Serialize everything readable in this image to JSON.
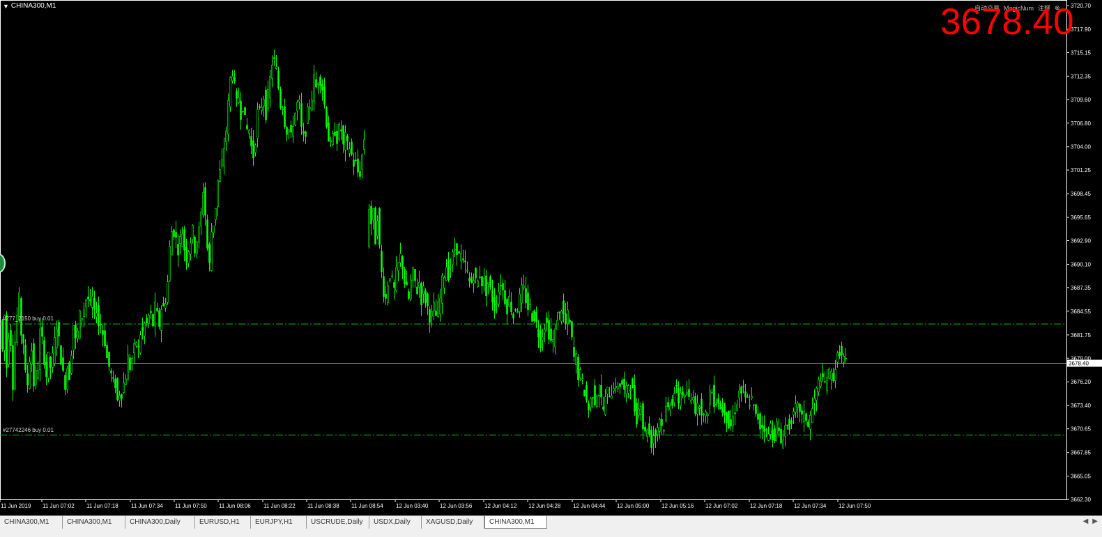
{
  "symbol": "CHINA300,M1",
  "current_price_big": "3678.40",
  "current_price_tag": "3678.40",
  "top_right": {
    "label1": "自动交易",
    "label2": "MagicNum",
    "label3": "注释"
  },
  "orders": [
    {
      "label": "#277_2150 buy 0.01",
      "price": 3683.05
    },
    {
      "label": "#27742246 buy 0.01",
      "price": 3669.9
    }
  ],
  "price_axis": [
    "3720.70",
    "3717.90",
    "3715.15",
    "3712.35",
    "3709.60",
    "3706.80",
    "3704.00",
    "3701.25",
    "3698.45",
    "3695.65",
    "3692.90",
    "3690.10",
    "3687.35",
    "3684.55",
    "3681.75",
    "3679.00",
    "3676.20",
    "3673.40",
    "3670.65",
    "3667.85",
    "3665.05",
    "3662.30"
  ],
  "time_axis": [
    "11 Jun 2019",
    "11 Jun 07:02",
    "11 Jun 07:18",
    "11 Jun 07:34",
    "11 Jun 07:50",
    "11 Jun 08:06",
    "11 Jun 08:22",
    "11 Jun 08:38",
    "11 Jun 08:54",
    "12 Jun 03:40",
    "12 Jun 03:56",
    "12 Jun 04:12",
    "12 Jun 04:28",
    "12 Jun 04:44",
    "12 Jun 05:00",
    "12 Jun 05:16",
    "12 Jun 07:02",
    "12 Jun 07:18",
    "12 Jun 07:34",
    "12 Jun 07:50"
  ],
  "tabs": [
    "CHINA300,M1",
    "CHINA300,M1",
    "CHINA300,Daily",
    "EURUSD,H1",
    "EURJPY,H1",
    "USCRUDE,Daily",
    "USDX,Daily",
    "XAGUSD,Daily",
    "CHINA300,M1"
  ],
  "active_tab": 8,
  "colors": {
    "candle": "#00ff00",
    "background": "#000000",
    "price_text": "#ff0000",
    "axis": "#ffffff",
    "order_line": "#00cc00"
  },
  "chart_data": {
    "type": "candlestick",
    "ylim": [
      3662.3,
      3720.7
    ],
    "close_path": [
      [
        0,
        3683.5
      ],
      [
        3,
        3680
      ],
      [
        6,
        3684
      ],
      [
        9,
        3678
      ],
      [
        12,
        3682
      ],
      [
        15,
        3681
      ],
      [
        18,
        3676
      ],
      [
        21,
        3681
      ],
      [
        24,
        3684
      ],
      [
        27,
        3686
      ],
      [
        30,
        3682
      ],
      [
        33,
        3681
      ],
      [
        36,
        3677
      ],
      [
        39,
        3676
      ],
      [
        42,
        3679
      ],
      [
        45,
        3680
      ],
      [
        48,
        3676
      ],
      [
        51,
        3677
      ],
      [
        54,
        3678
      ],
      [
        57,
        3682
      ],
      [
        60,
        3681
      ],
      [
        63,
        3679
      ],
      [
        66,
        3677
      ],
      [
        69,
        3679
      ],
      [
        72,
        3678
      ],
      [
        75,
        3679
      ],
      [
        78,
        3681
      ],
      [
        81,
        3683
      ],
      [
        84,
        3681
      ],
      [
        87,
        3679
      ],
      [
        90,
        3677
      ],
      [
        93,
        3676
      ],
      [
        96,
        3678
      ],
      [
        99,
        3677
      ],
      [
        102,
        3680
      ],
      [
        105,
        3683
      ],
      [
        108,
        3681
      ],
      [
        111,
        3682
      ],
      [
        114,
        3684
      ],
      [
        117,
        3684
      ],
      [
        120,
        3685
      ],
      [
        123,
        3686
      ],
      [
        126,
        3686
      ],
      [
        129,
        3685
      ],
      [
        132,
        3686
      ],
      [
        135,
        3684
      ],
      [
        138,
        3685
      ],
      [
        141,
        3683
      ],
      [
        144,
        3683
      ],
      [
        147,
        3682
      ],
      [
        150,
        3681
      ],
      [
        153,
        3679
      ],
      [
        156,
        3678
      ],
      [
        159,
        3677
      ],
      [
        162,
        3676
      ],
      [
        165,
        3676
      ],
      [
        168,
        3674
      ],
      [
        171,
        3675
      ],
      [
        174,
        3675
      ],
      [
        177,
        3676
      ],
      [
        180,
        3677
      ],
      [
        183,
        3679
      ],
      [
        186,
        3678
      ],
      [
        189,
        3679
      ],
      [
        192,
        3680
      ],
      [
        195,
        3681
      ],
      [
        198,
        3680
      ],
      [
        201,
        3682
      ],
      [
        204,
        3682
      ],
      [
        207,
        3683
      ],
      [
        210,
        3683
      ],
      [
        213,
        3684
      ],
      [
        216,
        3684
      ],
      [
        219,
        3683
      ],
      [
        222,
        3685
      ],
      [
        225,
        3684
      ],
      [
        228,
        3683
      ],
      [
        231,
        3685
      ],
      [
        234,
        3685
      ],
      [
        237,
        3686
      ],
      [
        240,
        3688
      ],
      [
        243,
        3692
      ],
      [
        246,
        3694
      ],
      [
        249,
        3694
      ],
      [
        252,
        3693
      ],
      [
        255,
        3692
      ],
      [
        258,
        3693
      ],
      [
        261,
        3694
      ],
      [
        264,
        3692
      ],
      [
        267,
        3691
      ],
      [
        270,
        3692
      ],
      [
        273,
        3693
      ],
      [
        276,
        3694
      ],
      [
        279,
        3692
      ],
      [
        282,
        3693
      ],
      [
        285,
        3694
      ],
      [
        288,
        3696
      ],
      [
        291,
        3699
      ],
      [
        294,
        3696
      ],
      [
        297,
        3692
      ],
      [
        300,
        3690
      ],
      [
        303,
        3694
      ],
      [
        306,
        3695
      ],
      [
        309,
        3697
      ],
      [
        312,
        3700
      ],
      [
        315,
        3701
      ],
      [
        318,
        3702
      ],
      [
        321,
        3704
      ],
      [
        324,
        3706
      ],
      [
        327,
        3709
      ],
      [
        330,
        3712
      ],
      [
        333,
        3713
      ],
      [
        336,
        3711
      ],
      [
        339,
        3709
      ],
      [
        342,
        3710
      ],
      [
        345,
        3708
      ],
      [
        348,
        3709
      ],
      [
        351,
        3707
      ],
      [
        354,
        3706
      ],
      [
        357,
        3706
      ],
      [
        360,
        3704
      ],
      [
        363,
        3703
      ],
      [
        366,
        3705
      ],
      [
        369,
        3708
      ],
      [
        372,
        3708
      ],
      [
        375,
        3709
      ],
      [
        378,
        3710
      ],
      [
        381,
        3708
      ],
      [
        384,
        3710
      ],
      [
        387,
        3712
      ],
      [
        390,
        3714
      ],
      [
        393,
        3714
      ],
      [
        396,
        3713
      ],
      [
        399,
        3711
      ],
      [
        402,
        3709
      ],
      [
        405,
        3709
      ],
      [
        408,
        3707
      ],
      [
        411,
        3706
      ],
      [
        414,
        3706
      ],
      [
        417,
        3705
      ],
      [
        420,
        3707
      ],
      [
        423,
        3708
      ],
      [
        426,
        3709
      ],
      [
        429,
        3709
      ],
      [
        432,
        3706
      ],
      [
        435,
        3705
      ],
      [
        438,
        3706
      ],
      [
        441,
        3708
      ],
      [
        444,
        3709
      ],
      [
        447,
        3710
      ],
      [
        450,
        3712
      ],
      [
        453,
        3711
      ],
      [
        456,
        3712
      ],
      [
        459,
        3712
      ],
      [
        462,
        3711
      ],
      [
        465,
        3709
      ],
      [
        468,
        3707
      ],
      [
        471,
        3705
      ],
      [
        474,
        3704
      ],
      [
        477,
        3705
      ],
      [
        480,
        3706
      ],
      [
        483,
        3705
      ],
      [
        486,
        3706
      ],
      [
        489,
        3706
      ],
      [
        492,
        3704
      ],
      [
        495,
        3705
      ],
      [
        498,
        3704
      ],
      [
        501,
        3704
      ],
      [
        504,
        3703
      ],
      [
        507,
        3702
      ],
      [
        510,
        3702
      ],
      [
        513,
        3701
      ],
      [
        516,
        3701
      ],
      [
        519,
        3703
      ],
      [
        522,
        3705
      ],
      [
        526,
        3692
      ],
      [
        529,
        3697
      ],
      [
        532,
        3695
      ],
      [
        535,
        3696
      ],
      [
        538,
        3693
      ],
      [
        541,
        3696
      ],
      [
        544,
        3692
      ],
      [
        547,
        3689
      ],
      [
        550,
        3687
      ],
      [
        553,
        3686
      ],
      [
        556,
        3688
      ],
      [
        559,
        3689
      ],
      [
        562,
        3688
      ],
      [
        565,
        3687
      ],
      [
        568,
        3689
      ],
      [
        571,
        3690
      ],
      [
        574,
        3691
      ],
      [
        577,
        3690
      ],
      [
        580,
        3688
      ],
      [
        583,
        3687
      ],
      [
        586,
        3686
      ],
      [
        589,
        3688
      ],
      [
        592,
        3689
      ],
      [
        595,
        3688
      ],
      [
        598,
        3687
      ],
      [
        601,
        3688
      ],
      [
        604,
        3686
      ],
      [
        607,
        3687
      ],
      [
        610,
        3686
      ],
      [
        613,
        3685
      ],
      [
        616,
        3684
      ],
      [
        619,
        3684
      ],
      [
        622,
        3685
      ],
      [
        625,
        3684
      ],
      [
        628,
        3685
      ],
      [
        631,
        3686
      ],
      [
        634,
        3688
      ],
      [
        637,
        3689
      ],
      [
        640,
        3690
      ],
      [
        643,
        3689
      ],
      [
        646,
        3690
      ],
      [
        649,
        3691
      ],
      [
        652,
        3692
      ],
      [
        655,
        3692
      ],
      [
        658,
        3691
      ],
      [
        661,
        3691
      ],
      [
        664,
        3690
      ],
      [
        667,
        3690
      ],
      [
        670,
        3689
      ],
      [
        673,
        3688
      ],
      [
        676,
        3688
      ],
      [
        679,
        3689
      ],
      [
        682,
        3688
      ],
      [
        685,
        3688
      ],
      [
        688,
        3689
      ],
      [
        691,
        3688
      ],
      [
        694,
        3688
      ],
      [
        697,
        3687
      ],
      [
        700,
        3688
      ],
      [
        703,
        3687
      ],
      [
        706,
        3686
      ],
      [
        709,
        3685
      ],
      [
        712,
        3686
      ],
      [
        715,
        3687
      ],
      [
        718,
        3688
      ],
      [
        721,
        3687
      ],
      [
        724,
        3686
      ],
      [
        727,
        3685
      ],
      [
        730,
        3686
      ],
      [
        733,
        3685
      ],
      [
        736,
        3684
      ],
      [
        739,
        3685
      ],
      [
        742,
        3685
      ],
      [
        745,
        3686
      ],
      [
        748,
        3687
      ],
      [
        751,
        3687
      ],
      [
        754,
        3686
      ],
      [
        757,
        3685
      ],
      [
        760,
        3685
      ],
      [
        763,
        3684
      ],
      [
        766,
        3684
      ],
      [
        769,
        3683
      ],
      [
        772,
        3682
      ],
      [
        775,
        3681
      ],
      [
        778,
        3682
      ],
      [
        781,
        3683
      ],
      [
        784,
        3683
      ],
      [
        787,
        3682
      ],
      [
        790,
        3681
      ],
      [
        793,
        3681
      ],
      [
        796,
        3682
      ],
      [
        799,
        3684
      ],
      [
        802,
        3684
      ],
      [
        805,
        3685
      ],
      [
        808,
        3684
      ],
      [
        811,
        3683
      ],
      [
        814,
        3684
      ],
      [
        817,
        3683
      ],
      [
        820,
        3681
      ],
      [
        823,
        3679
      ],
      [
        826,
        3679
      ],
      [
        829,
        3677
      ],
      [
        832,
        3677
      ],
      [
        835,
        3676
      ],
      [
        838,
        3675
      ],
      [
        841,
        3674
      ],
      [
        844,
        3673
      ],
      [
        847,
        3674
      ],
      [
        850,
        3675
      ],
      [
        853,
        3674
      ],
      [
        856,
        3675
      ],
      [
        859,
        3675
      ],
      [
        862,
        3674
      ],
      [
        865,
        3673
      ],
      [
        868,
        3674
      ],
      [
        871,
        3675
      ],
      [
        874,
        3675
      ],
      [
        877,
        3675
      ],
      [
        880,
        3676
      ],
      [
        883,
        3675
      ],
      [
        886,
        3676
      ],
      [
        889,
        3676
      ],
      [
        892,
        3676
      ],
      [
        895,
        3675
      ],
      [
        898,
        3675
      ],
      [
        901,
        3676
      ],
      [
        904,
        3676
      ],
      [
        907,
        3675
      ],
      [
        910,
        3673
      ],
      [
        913,
        3672
      ],
      [
        916,
        3673
      ],
      [
        919,
        3674
      ],
      [
        922,
        3671
      ],
      [
        925,
        3670
      ],
      [
        928,
        3671
      ],
      [
        931,
        3670
      ],
      [
        934,
        3669
      ],
      [
        937,
        3670
      ],
      [
        940,
        3670
      ],
      [
        943,
        3671
      ],
      [
        946,
        3672
      ],
      [
        949,
        3671
      ],
      [
        952,
        3671
      ],
      [
        955,
        3673
      ],
      [
        958,
        3673
      ],
      [
        961,
        3674
      ],
      [
        964,
        3674
      ],
      [
        967,
        3675
      ],
      [
        970,
        3675
      ],
      [
        973,
        3674
      ],
      [
        976,
        3675
      ],
      [
        979,
        3675
      ],
      [
        982,
        3674
      ],
      [
        985,
        3675
      ],
      [
        988,
        3674
      ],
      [
        991,
        3674
      ],
      [
        994,
        3675
      ],
      [
        997,
        3673
      ],
      [
        1000,
        3673
      ],
      [
        1003,
        3674
      ],
      [
        1006,
        3673
      ],
      [
        1009,
        3672
      ],
      [
        1012,
        3672
      ],
      [
        1015,
        3673
      ],
      [
        1018,
        3675
      ],
      [
        1021,
        3675
      ],
      [
        1024,
        3674
      ],
      [
        1027,
        3674
      ],
      [
        1030,
        3674
      ],
      [
        1033,
        3673
      ],
      [
        1036,
        3673
      ],
      [
        1039,
        3673
      ],
      [
        1042,
        3672
      ],
      [
        1045,
        3671
      ],
      [
        1048,
        3671
      ],
      [
        1051,
        3672
      ],
      [
        1054,
        3673
      ],
      [
        1057,
        3674
      ],
      [
        1060,
        3675
      ],
      [
        1063,
        3675
      ],
      [
        1066,
        3675
      ],
      [
        1069,
        3674
      ],
      [
        1072,
        3674
      ],
      [
        1075,
        3674
      ],
      [
        1078,
        3674
      ],
      [
        1081,
        3673
      ],
      [
        1084,
        3672
      ],
      [
        1087,
        3672
      ],
      [
        1090,
        3671
      ],
      [
        1093,
        3671
      ],
      [
        1096,
        3671
      ],
      [
        1099,
        3670
      ],
      [
        1102,
        3670
      ],
      [
        1105,
        3671
      ],
      [
        1108,
        3670
      ],
      [
        1111,
        3670
      ],
      [
        1114,
        3671
      ],
      [
        1117,
        3670
      ],
      [
        1120,
        3669
      ],
      [
        1123,
        3670
      ],
      [
        1126,
        3671
      ],
      [
        1129,
        3671
      ],
      [
        1132,
        3671
      ],
      [
        1135,
        3672
      ],
      [
        1138,
        3672
      ],
      [
        1141,
        3673
      ],
      [
        1144,
        3673
      ],
      [
        1147,
        3673
      ],
      [
        1150,
        3672
      ],
      [
        1153,
        3672
      ],
      [
        1156,
        3672
      ],
      [
        1159,
        3671
      ],
      [
        1162,
        3672
      ],
      [
        1165,
        3673
      ],
      [
        1168,
        3674
      ],
      [
        1171,
        3675
      ],
      [
        1174,
        3676
      ],
      [
        1177,
        3677
      ],
      [
        1180,
        3676
      ],
      [
        1183,
        3676
      ],
      [
        1186,
        3677
      ],
      [
        1189,
        3677
      ],
      [
        1192,
        3677
      ],
      [
        1195,
        3677
      ],
      [
        1198,
        3678
      ],
      [
        1201,
        3679
      ],
      [
        1204,
        3680
      ],
      [
        1207,
        3679
      ],
      [
        1210,
        3679
      ],
      [
        1213,
        3678.4
      ]
    ]
  }
}
